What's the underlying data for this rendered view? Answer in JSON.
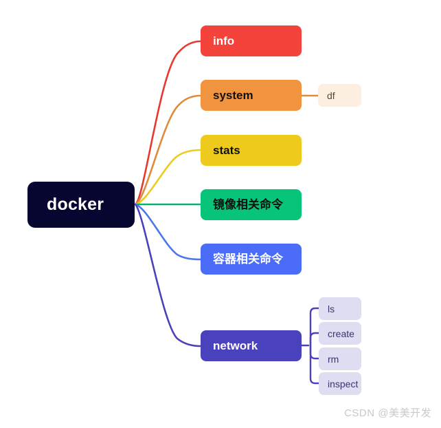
{
  "diagram": {
    "type": "mindmap",
    "title": "docker",
    "root": {
      "id": "docker",
      "label": "docker",
      "color": "#060630",
      "text_color": "#ffffff"
    },
    "branches": [
      {
        "id": "info",
        "label": "info",
        "color": "#F4433A",
        "text_color": "#ffffff",
        "children": []
      },
      {
        "id": "system",
        "label": "system",
        "color": "#F09440",
        "text_color": "#111111",
        "children": [
          {
            "id": "df",
            "label": "df",
            "color": "#FCEEE1",
            "text_color": "#5a4632"
          }
        ]
      },
      {
        "id": "stats",
        "label": "stats",
        "color": "#EDCA1C",
        "text_color": "#111111",
        "children": []
      },
      {
        "id": "image-commands",
        "label": "镜像相关命令",
        "color": "#08C478",
        "text_color": "#111111",
        "children": []
      },
      {
        "id": "container-commands",
        "label": "容器相关命令",
        "color": "#4A6CF7",
        "text_color": "#ffffff",
        "children": []
      },
      {
        "id": "network",
        "label": "network",
        "color": "#4A42BD",
        "text_color": "#ffffff",
        "children": [
          {
            "id": "ls",
            "label": "ls",
            "color": "#DEDDF2",
            "text_color": "#3b3470"
          },
          {
            "id": "create",
            "label": "create",
            "color": "#DEDDF2",
            "text_color": "#3b3470"
          },
          {
            "id": "rm",
            "label": "rm",
            "color": "#DEDDF2",
            "text_color": "#3b3470"
          },
          {
            "id": "inspect",
            "label": "inspect",
            "color": "#DEDDF2",
            "text_color": "#3b3470"
          }
        ]
      }
    ],
    "connector_colors": {
      "info": "#E8392F",
      "system": "#E08A3C",
      "stats": "#EDCA1C",
      "image-commands": "#09B06F",
      "container-commands": "#4A77EE",
      "network": "#4A42BD",
      "df": "#E08A3C",
      "network-children": "#4A42BD"
    },
    "watermark": "CSDN @美美开发"
  }
}
